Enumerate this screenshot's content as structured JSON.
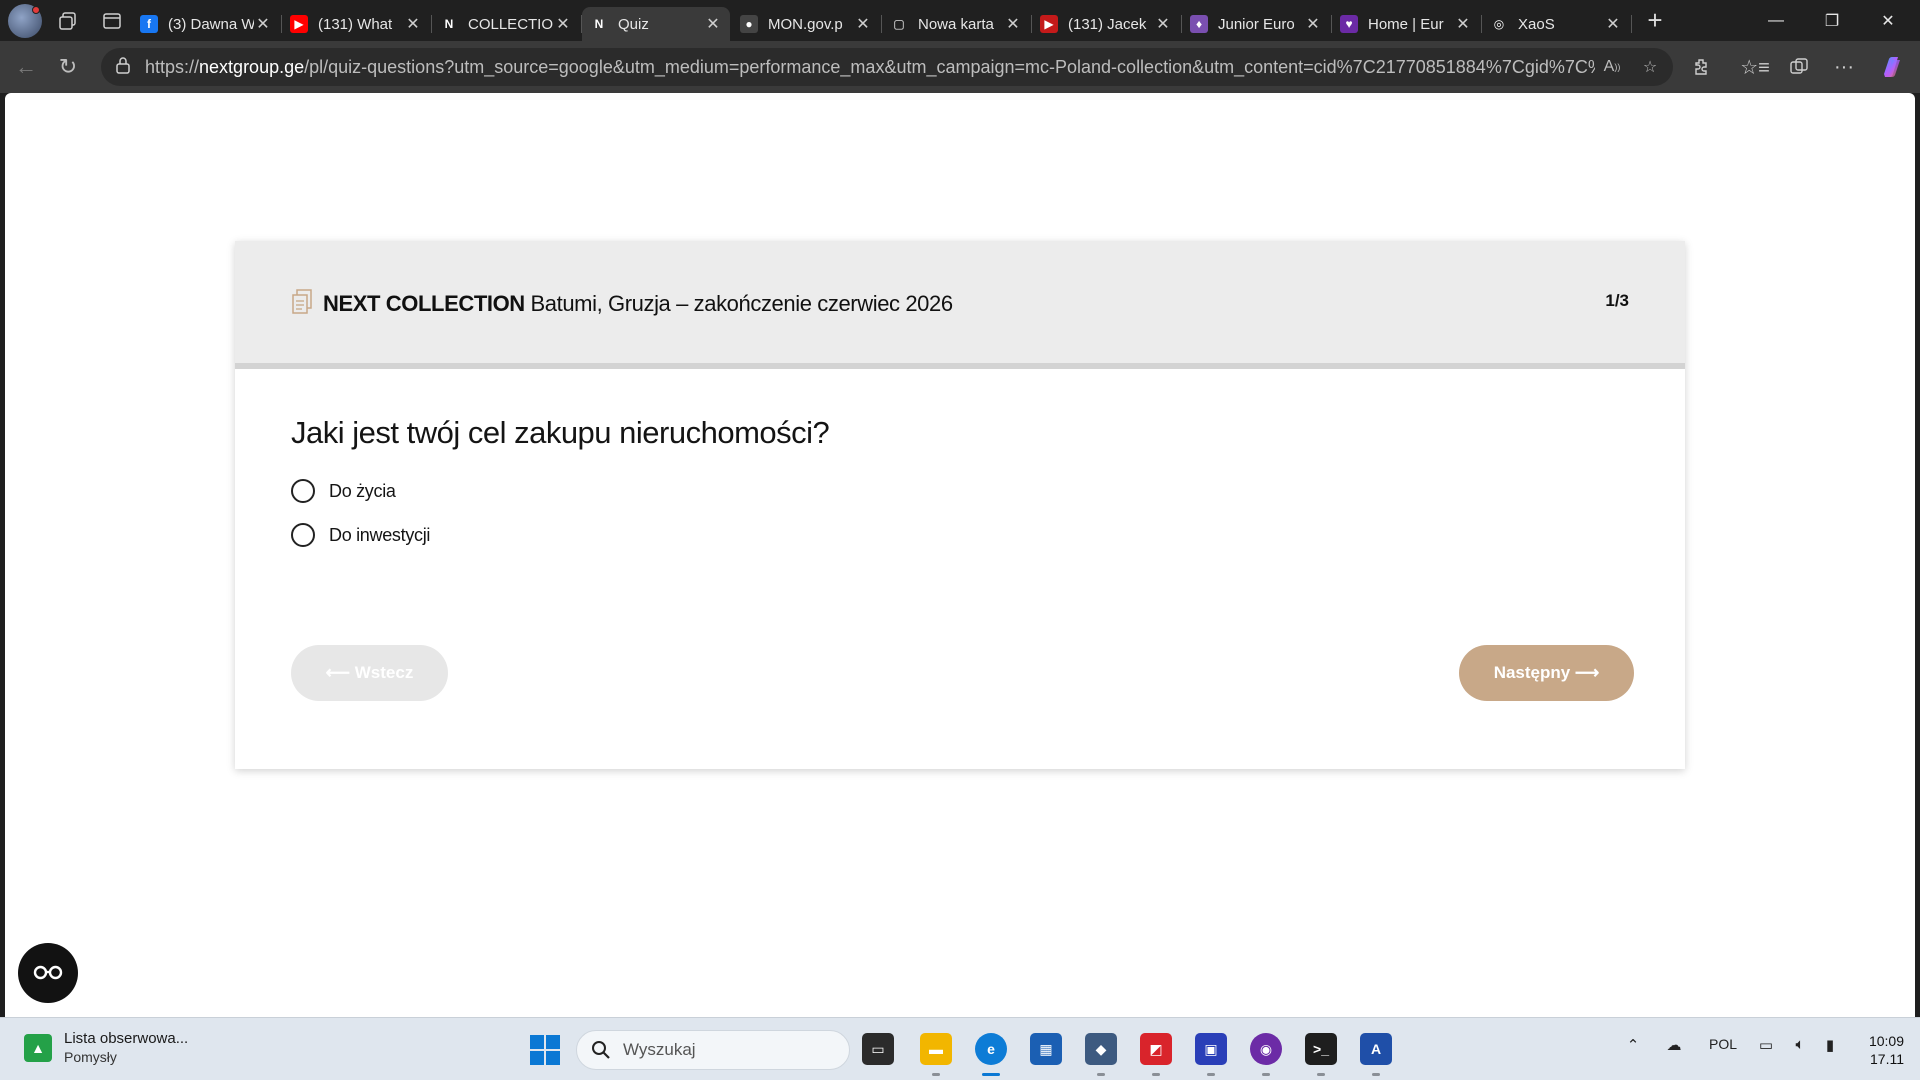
{
  "browser": {
    "tabs": [
      {
        "title": "(3) Dawna W",
        "icon": "facebook-icon",
        "color": "#1877f2",
        "glyph": "f"
      },
      {
        "title": "(131) What",
        "icon": "youtube-icon",
        "color": "#ff0000",
        "glyph": "▶"
      },
      {
        "title": "COLLECTIO",
        "icon": "next-logo-icon",
        "color": "#202020",
        "glyph": "N"
      },
      {
        "title": "Quiz",
        "icon": "next-logo-icon",
        "color": "#3a3a3a",
        "glyph": "N",
        "active": true
      },
      {
        "title": "MON.gov.p",
        "icon": "github-icon",
        "color": "#444444",
        "glyph": "●"
      },
      {
        "title": "Nowa karta",
        "icon": "new-tab-icon",
        "color": "#202020",
        "glyph": "▢"
      },
      {
        "title": "(131) Jacek",
        "icon": "youtube-icon",
        "color": "#c41a1a",
        "glyph": "▶"
      },
      {
        "title": "Junior Euro",
        "icon": "junior-eurovision-icon",
        "color": "#7a4fb0",
        "glyph": "♦"
      },
      {
        "title": "Home | Eur",
        "icon": "eurovision-icon",
        "color": "#6b2aa5",
        "glyph": "♥"
      },
      {
        "title": "XaoS",
        "icon": "globe-icon",
        "color": "#202020",
        "glyph": "◎"
      }
    ],
    "url_prefix": "https://",
    "url_host": "nextgroup.ge",
    "url_rest": "/pl/quiz-questions?utm_source=google&utm_medium=performance_max&utm_campaign=mc-Poland-collection&utm_content=cid%7C21770851884%7Cgid%7C%..."
  },
  "page": {
    "brand": "NEXT COLLECTION",
    "subtitle": " Batumi, Gruzja – zakończenie czerwiec 2026",
    "counter": "1/3",
    "question": "Jaki jest twój cel zakupu nieruchomości?",
    "options": [
      "Do życia",
      "Do inwestycji"
    ],
    "back_label": "⟵ Wstecz",
    "next_label": "Następny ⟶",
    "accent_color": "#c8a888"
  },
  "taskbar": {
    "widget_title": "Lista obserwowa...",
    "widget_subtitle": "Pomysły",
    "search_placeholder": "Wyszukaj",
    "language": "POL",
    "time": "10:09",
    "date": "17.11"
  }
}
